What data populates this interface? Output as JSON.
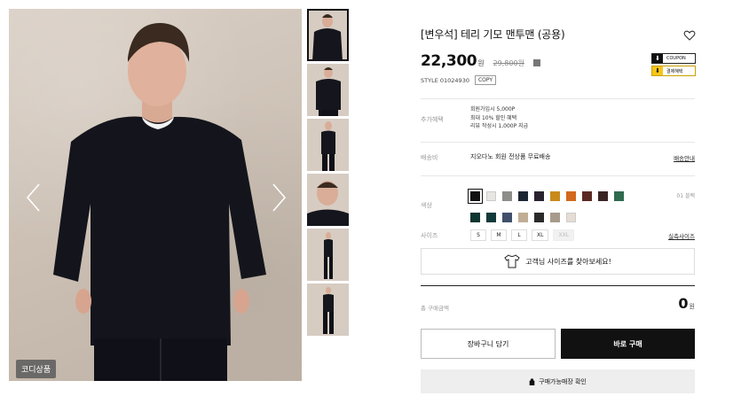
{
  "gallery": {
    "badge_label": "코디상품",
    "thumbnail_count": 6
  },
  "product": {
    "title": "[변우석] 테리 기모 맨투맨 (공용)",
    "price": "22,300",
    "price_unit": "원",
    "original_price": "29,800원",
    "style_label": "STYLE",
    "style_code": "01024930",
    "copy_label": "COPY",
    "coupons": [
      {
        "label": "COUPON"
      },
      {
        "label": "결제혜택"
      }
    ]
  },
  "benefit": {
    "label": "추가혜택",
    "lines": [
      "회원가입시 5,000P",
      "최대 10% 할인 혜택",
      "리뷰 작성시 1,000P 지급"
    ]
  },
  "delivery": {
    "label": "배송비",
    "text": "지오다노 회원 전상품 무료배송",
    "link": "배송안내"
  },
  "color": {
    "label": "색상",
    "count_text": "01 블랙",
    "swatches": [
      "#111111",
      "#e8e6e2",
      "#8d8e8a",
      "#1c2633",
      "#2b2230",
      "#c98a1a",
      "#d2691e",
      "#5a2a22",
      "#3a2424",
      "#2f6b4f",
      "#0f3530",
      "#123a3a",
      "#41506a",
      "#c0ad95",
      "#2a2a2a",
      "#a89a8a",
      "#e6dcd3"
    ],
    "selected_index": 0
  },
  "size": {
    "label": "사이즈",
    "options": [
      "S",
      "M",
      "L",
      "XL",
      "XXL"
    ],
    "disabled_index": 4,
    "link": "실측사이즈"
  },
  "size_finder": {
    "text": "고객님 사이즈를 찾아보세요!"
  },
  "total": {
    "label": "총 구매금액",
    "value": "0",
    "unit": "원"
  },
  "actions": {
    "cart_label": "장바구니 담기",
    "buy_label": "바로 구매",
    "store_label": "구매가능매장 확인"
  },
  "colors": {
    "accent": "#111111",
    "coupon_yellow": "#f5c518",
    "background": "#ffffff"
  }
}
